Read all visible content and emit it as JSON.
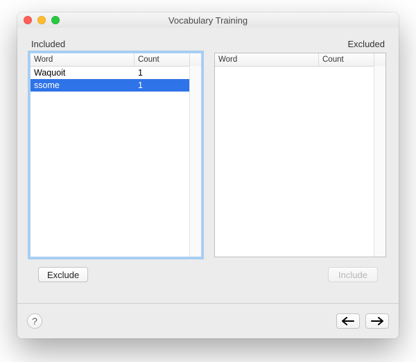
{
  "window": {
    "title": "Vocabulary Training"
  },
  "sections": {
    "included_label": "Included",
    "excluded_label": "Excluded"
  },
  "columns": {
    "word": "Word",
    "count": "Count"
  },
  "included": {
    "rows": [
      {
        "word": "Waquoit",
        "count": "1",
        "selected": false
      },
      {
        "word": "ssome",
        "count": "1",
        "selected": true
      }
    ]
  },
  "excluded": {
    "rows": []
  },
  "buttons": {
    "exclude": "Exclude",
    "include": "Include",
    "include_enabled": false
  },
  "footer": {
    "help": "?",
    "prev_icon": "arrow-left-icon",
    "next_icon": "arrow-right-icon"
  }
}
